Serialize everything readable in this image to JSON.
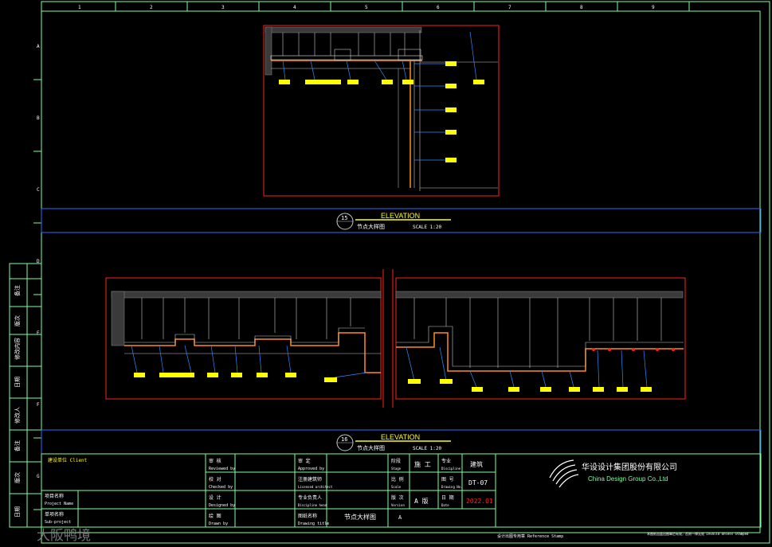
{
  "colors": {
    "frame": "#7fffa0",
    "detail_frame": "#ff2020",
    "band": "#2f6cff",
    "title_text": "#ffff00",
    "dimension": "#ff8c1a",
    "tag_fill": "#ffff00",
    "leader": "#2f8cff",
    "hatch": "#8a8a8a"
  },
  "grid": {
    "columns": [
      "1",
      "2",
      "3",
      "4",
      "5",
      "6",
      "7",
      "8",
      "9"
    ],
    "rows": [
      "A",
      "B",
      "C",
      "D",
      "E",
      "F",
      "G"
    ]
  },
  "views": [
    {
      "id": "view-15",
      "number": "15",
      "title": "ELEVATION",
      "subtitle": "节点大样图",
      "scale": "SCALE 1:20"
    },
    {
      "id": "view-16",
      "number": "16",
      "title": "ELEVATION",
      "subtitle": "节点大样图",
      "scale": "SCALE 1:20"
    }
  ],
  "left_strip": [
    "备注",
    "版次",
    "修改内容",
    "日期",
    "修改人",
    "备注",
    "版次",
    "日期"
  ],
  "titleblock": {
    "client_label": "建设单位 Client",
    "project_label": "项目名称",
    "project_label_en": "Project Name",
    "subproject_label": "单项名称",
    "subproject_label_en": "Sub-project",
    "reviewed_label": "审 核",
    "reviewed_en": "Reviewed by",
    "checked_label": "校 对",
    "checked_en": "Checked by",
    "designed_label": "设 计",
    "designed_en": "Designed by",
    "drawn_label": "绘 图",
    "drawn_en": "Drawn by",
    "approved_label": "审 定",
    "approved_en": "Approved by",
    "stamp_label": "注册建筑师",
    "stamp_en": "Licensed architect",
    "discipline_head_label": "专业负责人",
    "discipline_head_en": "Discipline head",
    "drawing_title_label": "图纸名称",
    "drawing_title_en": "Drawing title",
    "drawing_title": "节点大样图",
    "stage_label": "阶段",
    "stage_en": "Stage",
    "stage_value": "施 工",
    "discipline_label": "专业",
    "discipline_en": "Discipline",
    "discipline_value": "建筑",
    "ratio_label": "比 例",
    "ratio_en": "Scale",
    "number_label": "图 号",
    "number_en": "Drawing No.",
    "drawing_no": "DT-07",
    "version_label": "版 次",
    "version_en": "Version",
    "version_value": "A 版",
    "date_label": "日 期",
    "date_en": "Date",
    "date_value": "2022.01",
    "bottom_cell": "A"
  },
  "company": {
    "name_cn": "华设设计集团股份有限公司",
    "name_en": "China Design Group Co.,Ltd"
  },
  "footer": {
    "stamp_note": "设计出图专用章 Reference Stamp",
    "invalid_note": "本图纸加盖出图章后有效，否则一律无效 Invalid Unless Stamped"
  },
  "watermark": "大阪鸭境"
}
